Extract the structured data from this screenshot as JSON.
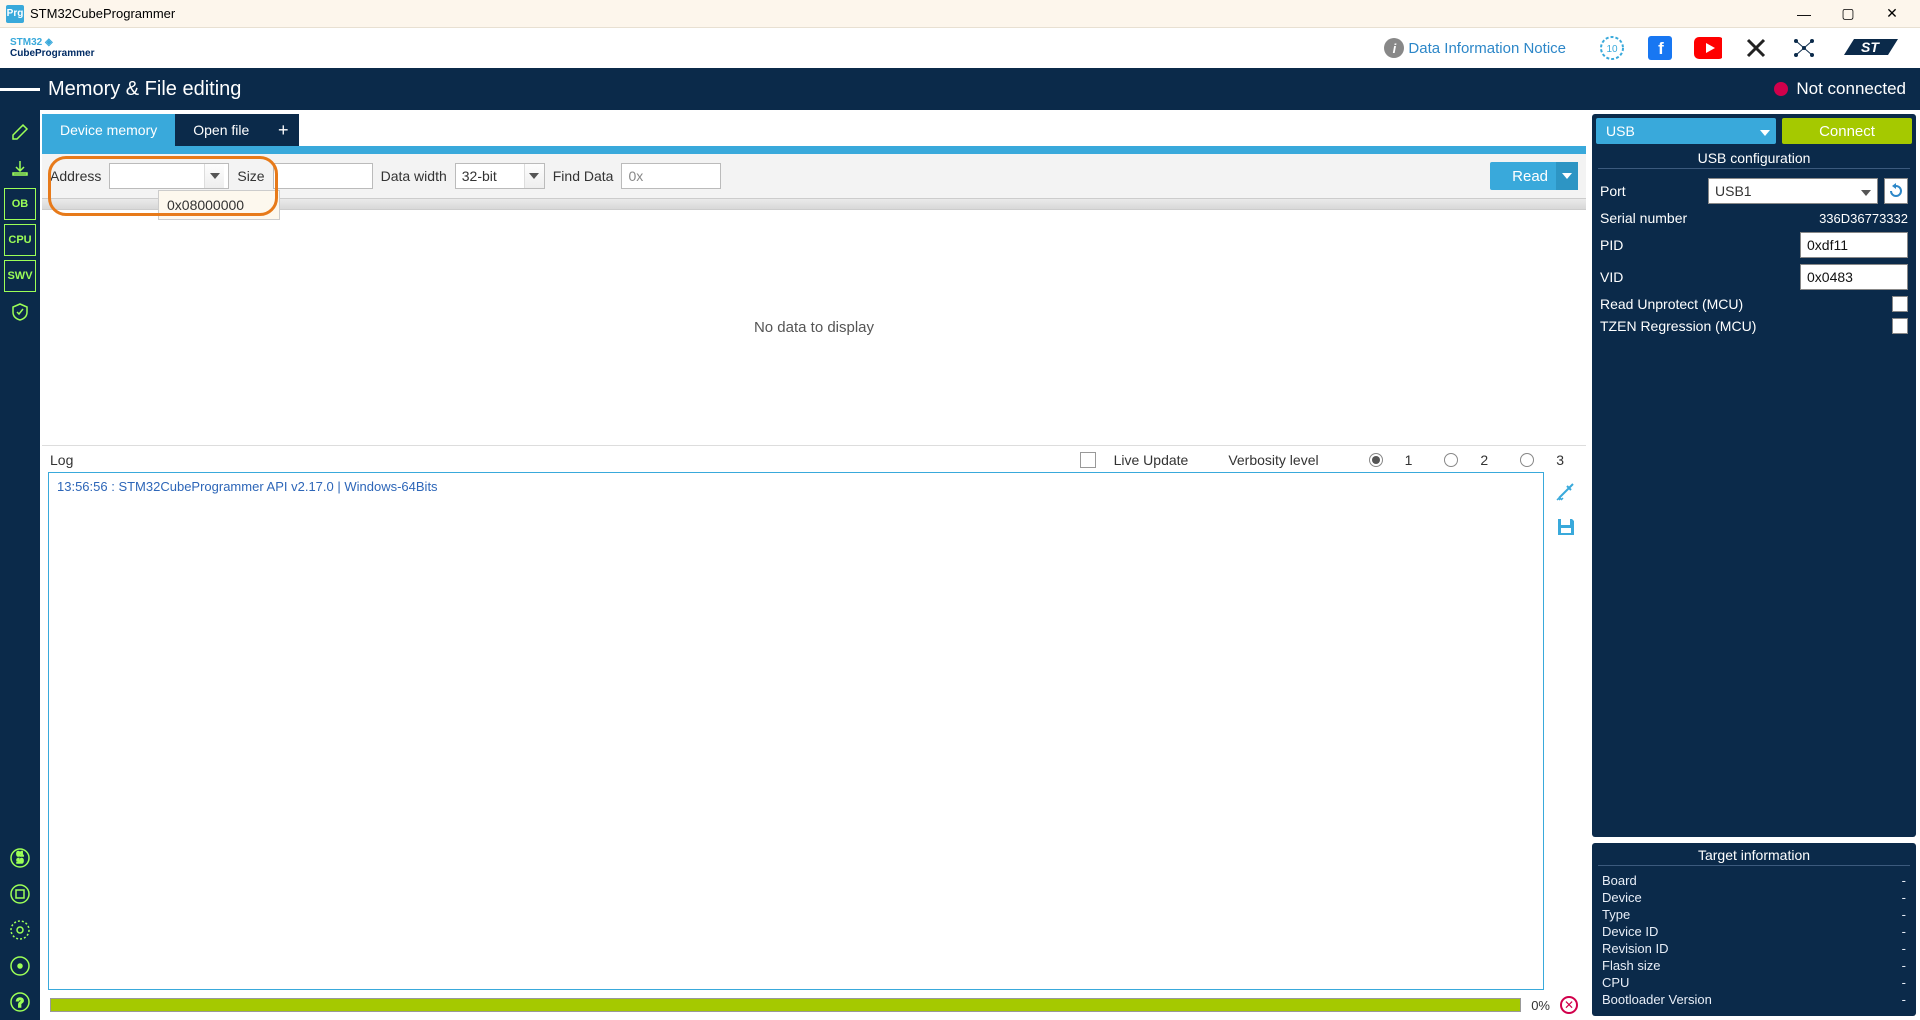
{
  "window": {
    "title": "STM32CubeProgrammer",
    "icon_text": "Prg"
  },
  "brand": {
    "logo_line1": "STM32",
    "logo_line2": "CubeProgrammer",
    "notice_link": "Data Information Notice"
  },
  "header": {
    "title": "Memory & File editing",
    "connection_status": "Not connected"
  },
  "leftTools": {
    "edit": "edit-icon",
    "download": "download-icon",
    "ob": "OB",
    "cpu": "CPU",
    "swv": "SWV",
    "shield": "shield-icon"
  },
  "tabs": {
    "device_memory": "Device memory",
    "open_file": "Open file",
    "plus": "+"
  },
  "toolbar": {
    "address_label": "Address",
    "address_value": "",
    "address_dropdown_option": "0x08000000",
    "size_label": "Size",
    "size_value": "",
    "datawidth_label": "Data width",
    "datawidth_value": "32-bit",
    "finddata_label": "Find Data",
    "finddata_value": "0x",
    "read_button": "Read"
  },
  "table": {
    "empty_text": "No data to display"
  },
  "log": {
    "title": "Log",
    "live_update": "Live Update",
    "verbosity_label": "Verbosity level",
    "levels": [
      "1",
      "2",
      "3"
    ],
    "selected_level": "1",
    "entries": [
      "13:56:56 : STM32CubeProgrammer API v2.17.0 | Windows-64Bits"
    ]
  },
  "progress": {
    "percent": "0%"
  },
  "conn": {
    "protocol": "USB",
    "connect_button": "Connect",
    "config_title": "USB configuration",
    "port_label": "Port",
    "port_value": "USB1",
    "serial_label": "Serial number",
    "serial_value": "336D36773332",
    "pid_label": "PID",
    "pid_value": "0xdf11",
    "vid_label": "VID",
    "vid_value": "0x0483",
    "read_unprotect": "Read Unprotect (MCU)",
    "tzen": "TZEN Regression (MCU)"
  },
  "target": {
    "title": "Target information",
    "rows": [
      {
        "label": "Board",
        "value": "-"
      },
      {
        "label": "Device",
        "value": "-"
      },
      {
        "label": "Type",
        "value": "-"
      },
      {
        "label": "Device ID",
        "value": "-"
      },
      {
        "label": "Revision ID",
        "value": "-"
      },
      {
        "label": "Flash size",
        "value": "-"
      },
      {
        "label": "CPU",
        "value": "-"
      },
      {
        "label": "Bootloader Version",
        "value": "-"
      }
    ]
  }
}
